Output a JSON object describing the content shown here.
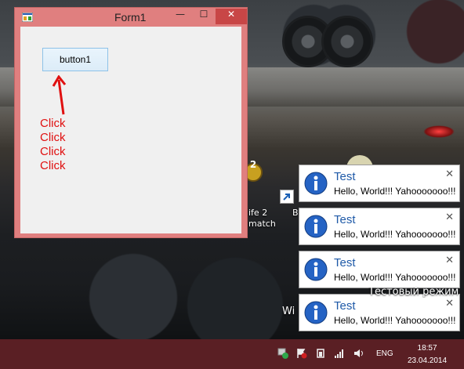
{
  "window": {
    "title": "Form1",
    "minimize": "—",
    "maximize": "☐",
    "close": "✕",
    "button1_label": "button1",
    "click_lines": [
      "Click",
      "Click",
      "Click",
      "Click"
    ]
  },
  "desktop": {
    "icon_label_line1": "ife 2",
    "icon_label_line2": "match",
    "icon_label_b": "B",
    "behind_text_w": "Wi",
    "behind_text_top": "Тестовый режим",
    "badge": "2"
  },
  "notifications": [
    {
      "title": "Test",
      "message": "Hello, World!!! Yahooooooo!!!",
      "close": "✕"
    },
    {
      "title": "Test",
      "message": "Hello, World!!! Yahooooooo!!!",
      "close": "✕"
    },
    {
      "title": "Test",
      "message": "Hello, World!!! Yahooooooo!!!",
      "close": "✕"
    },
    {
      "title": "Test",
      "message": "Hello, World!!! Yahooooooo!!!",
      "close": "✕"
    }
  ],
  "taskbar": {
    "language": "ENG",
    "time": "18:57",
    "date": "23.04.2014"
  },
  "colors": {
    "window_border": "#e07f7f",
    "close_button": "#c84646",
    "click_text": "#e01010",
    "toast_title": "#1f5aa8",
    "taskbar": "#5a1f24"
  }
}
